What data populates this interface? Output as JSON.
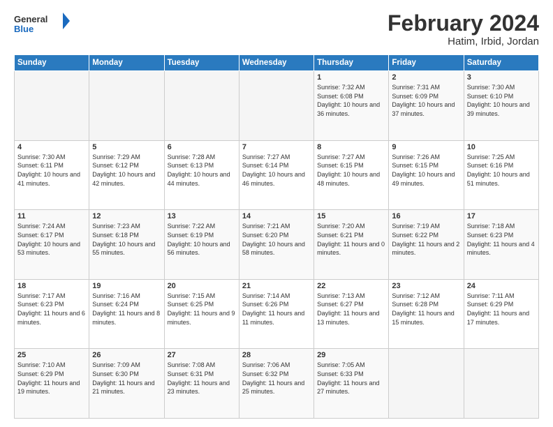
{
  "header": {
    "logo_general": "General",
    "logo_blue": "Blue",
    "month_year": "February 2024",
    "location": "Hatim, Irbid, Jordan"
  },
  "days_of_week": [
    "Sunday",
    "Monday",
    "Tuesday",
    "Wednesday",
    "Thursday",
    "Friday",
    "Saturday"
  ],
  "weeks": [
    [
      {
        "day": "",
        "info": ""
      },
      {
        "day": "",
        "info": ""
      },
      {
        "day": "",
        "info": ""
      },
      {
        "day": "",
        "info": ""
      },
      {
        "day": "1",
        "info": "Sunrise: 7:32 AM\nSunset: 6:08 PM\nDaylight: 10 hours\nand 36 minutes."
      },
      {
        "day": "2",
        "info": "Sunrise: 7:31 AM\nSunset: 6:09 PM\nDaylight: 10 hours\nand 37 minutes."
      },
      {
        "day": "3",
        "info": "Sunrise: 7:30 AM\nSunset: 6:10 PM\nDaylight: 10 hours\nand 39 minutes."
      }
    ],
    [
      {
        "day": "4",
        "info": "Sunrise: 7:30 AM\nSunset: 6:11 PM\nDaylight: 10 hours\nand 41 minutes."
      },
      {
        "day": "5",
        "info": "Sunrise: 7:29 AM\nSunset: 6:12 PM\nDaylight: 10 hours\nand 42 minutes."
      },
      {
        "day": "6",
        "info": "Sunrise: 7:28 AM\nSunset: 6:13 PM\nDaylight: 10 hours\nand 44 minutes."
      },
      {
        "day": "7",
        "info": "Sunrise: 7:27 AM\nSunset: 6:14 PM\nDaylight: 10 hours\nand 46 minutes."
      },
      {
        "day": "8",
        "info": "Sunrise: 7:27 AM\nSunset: 6:15 PM\nDaylight: 10 hours\nand 48 minutes."
      },
      {
        "day": "9",
        "info": "Sunrise: 7:26 AM\nSunset: 6:15 PM\nDaylight: 10 hours\nand 49 minutes."
      },
      {
        "day": "10",
        "info": "Sunrise: 7:25 AM\nSunset: 6:16 PM\nDaylight: 10 hours\nand 51 minutes."
      }
    ],
    [
      {
        "day": "11",
        "info": "Sunrise: 7:24 AM\nSunset: 6:17 PM\nDaylight: 10 hours\nand 53 minutes."
      },
      {
        "day": "12",
        "info": "Sunrise: 7:23 AM\nSunset: 6:18 PM\nDaylight: 10 hours\nand 55 minutes."
      },
      {
        "day": "13",
        "info": "Sunrise: 7:22 AM\nSunset: 6:19 PM\nDaylight: 10 hours\nand 56 minutes."
      },
      {
        "day": "14",
        "info": "Sunrise: 7:21 AM\nSunset: 6:20 PM\nDaylight: 10 hours\nand 58 minutes."
      },
      {
        "day": "15",
        "info": "Sunrise: 7:20 AM\nSunset: 6:21 PM\nDaylight: 11 hours\nand 0 minutes."
      },
      {
        "day": "16",
        "info": "Sunrise: 7:19 AM\nSunset: 6:22 PM\nDaylight: 11 hours\nand 2 minutes."
      },
      {
        "day": "17",
        "info": "Sunrise: 7:18 AM\nSunset: 6:23 PM\nDaylight: 11 hours\nand 4 minutes."
      }
    ],
    [
      {
        "day": "18",
        "info": "Sunrise: 7:17 AM\nSunset: 6:23 PM\nDaylight: 11 hours\nand 6 minutes."
      },
      {
        "day": "19",
        "info": "Sunrise: 7:16 AM\nSunset: 6:24 PM\nDaylight: 11 hours\nand 8 minutes."
      },
      {
        "day": "20",
        "info": "Sunrise: 7:15 AM\nSunset: 6:25 PM\nDaylight: 11 hours\nand 9 minutes."
      },
      {
        "day": "21",
        "info": "Sunrise: 7:14 AM\nSunset: 6:26 PM\nDaylight: 11 hours\nand 11 minutes."
      },
      {
        "day": "22",
        "info": "Sunrise: 7:13 AM\nSunset: 6:27 PM\nDaylight: 11 hours\nand 13 minutes."
      },
      {
        "day": "23",
        "info": "Sunrise: 7:12 AM\nSunset: 6:28 PM\nDaylight: 11 hours\nand 15 minutes."
      },
      {
        "day": "24",
        "info": "Sunrise: 7:11 AM\nSunset: 6:29 PM\nDaylight: 11 hours\nand 17 minutes."
      }
    ],
    [
      {
        "day": "25",
        "info": "Sunrise: 7:10 AM\nSunset: 6:29 PM\nDaylight: 11 hours\nand 19 minutes."
      },
      {
        "day": "26",
        "info": "Sunrise: 7:09 AM\nSunset: 6:30 PM\nDaylight: 11 hours\nand 21 minutes."
      },
      {
        "day": "27",
        "info": "Sunrise: 7:08 AM\nSunset: 6:31 PM\nDaylight: 11 hours\nand 23 minutes."
      },
      {
        "day": "28",
        "info": "Sunrise: 7:06 AM\nSunset: 6:32 PM\nDaylight: 11 hours\nand 25 minutes."
      },
      {
        "day": "29",
        "info": "Sunrise: 7:05 AM\nSunset: 6:33 PM\nDaylight: 11 hours\nand 27 minutes."
      },
      {
        "day": "",
        "info": ""
      },
      {
        "day": "",
        "info": ""
      }
    ]
  ]
}
